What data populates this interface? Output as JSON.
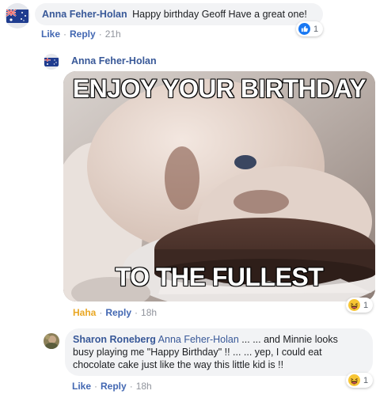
{
  "comment1": {
    "author": "Anna Feher-Holan",
    "text": "Happy birthday Geoff Have a great one!",
    "actions": {
      "like": "Like",
      "reply": "Reply",
      "sep": "·",
      "time": "21h"
    },
    "reaction_count": "1"
  },
  "comment2": {
    "author": "Anna Feher-Holan",
    "meme_top": "ENJOY YOUR BIRTHDAY",
    "meme_bottom": "TO THE FULLEST",
    "actions": {
      "haha": "Haha",
      "reply": "Reply",
      "sep": "·",
      "time": "18h"
    },
    "reaction_count": "1"
  },
  "comment3": {
    "author": "Sharon Roneberg",
    "mention": "Anna Feher-Holan",
    "text_line1_rest": " ... ... and Minnie looks",
    "text_line2": "busy playing me \"Happy Birthday\" !! ... ... yep, I could eat",
    "text_line3": "chocolate cake just like the way this little kid is !!",
    "actions": {
      "like": "Like",
      "reply": "Reply",
      "sep": "·",
      "time": "18h"
    },
    "reaction_count": "1"
  }
}
